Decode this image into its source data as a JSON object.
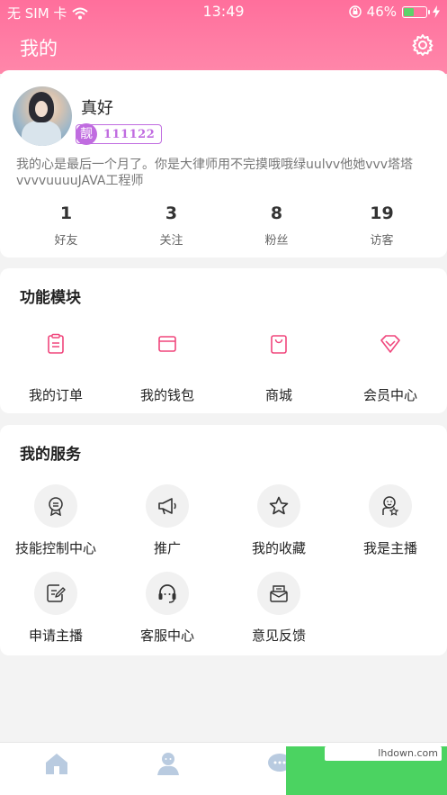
{
  "statusbar": {
    "carrier": "无 SIM 卡",
    "time": "13:49",
    "battery": "46%",
    "battery_level": 0.46
  },
  "header": {
    "title": "我的"
  },
  "profile": {
    "name": "真好",
    "badge_tag": "靓",
    "badge_number": "111122",
    "bio": "我的心是最后一个月了。你是大律师用不完摸哦哦绿uulvv他她vvv塔塔vvvvuuuuJAVA工程师",
    "stats": [
      {
        "value": "1",
        "label": "好友"
      },
      {
        "value": "3",
        "label": "关注"
      },
      {
        "value": "8",
        "label": "粉丝"
      },
      {
        "value": "19",
        "label": "访客"
      }
    ]
  },
  "functions": {
    "title": "功能模块",
    "items": [
      {
        "label": "我的订单",
        "icon": "order-icon"
      },
      {
        "label": "我的钱包",
        "icon": "wallet-icon"
      },
      {
        "label": "商城",
        "icon": "shopping-bag-icon"
      },
      {
        "label": "会员中心",
        "icon": "diamond-icon"
      }
    ]
  },
  "services": {
    "title": "我的服务",
    "items": [
      {
        "label": "技能控制中心",
        "icon": "medal-icon"
      },
      {
        "label": "推广",
        "icon": "megaphone-icon"
      },
      {
        "label": "我的收藏",
        "icon": "star-icon"
      },
      {
        "label": "我是主播",
        "icon": "anchor-badge-icon"
      },
      {
        "label": "申请主播",
        "icon": "edit-form-icon"
      },
      {
        "label": "客服中心",
        "icon": "headset-icon"
      },
      {
        "label": "意见反馈",
        "icon": "mail-feedback-icon"
      }
    ]
  },
  "tabbar": {
    "icons": [
      "home-icon",
      "user-group-icon",
      "chat-icon"
    ]
  },
  "watermark": {
    "text": "lhdown.com"
  },
  "colors": {
    "accent": "#ff6f9c",
    "badge": "#c06ce0",
    "icon_pink": "#f0467c"
  }
}
